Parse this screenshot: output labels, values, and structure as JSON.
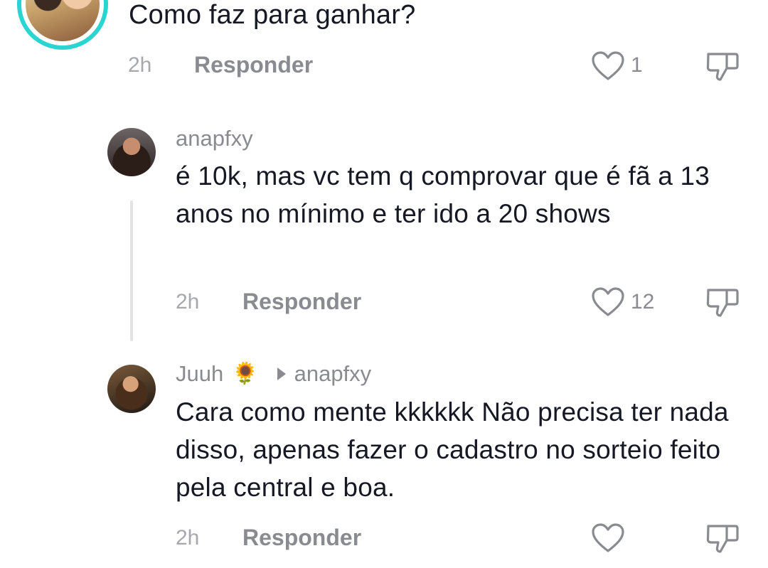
{
  "comments": [
    {
      "text": "Como faz para ganhar?",
      "time": "2h",
      "reply_label": "Responder",
      "likes": "1"
    },
    {
      "username": "anapfxy",
      "text": "é 10k, mas vc tem q comprovar que é fã a 13 anos no mínimo e ter ido a 20 shows",
      "time": "2h",
      "reply_label": "Responder",
      "likes": "12"
    },
    {
      "username": "Juuh",
      "emoji": "🌻",
      "reply_to": "anapfxy",
      "text": "Cara como mente kkkkkk Não precisa ter nada disso, apenas fazer o cadastro no sorteio feito pela central e boa.",
      "time": "2h",
      "reply_label": "Responder",
      "likes": ""
    }
  ],
  "icons": {
    "like": "heart-outline-icon",
    "dislike": "thumbs-down-outline-icon"
  },
  "colors": {
    "avatar_ring": "#2ad4d1",
    "text": "#161823",
    "muted": "#8a8b91"
  }
}
